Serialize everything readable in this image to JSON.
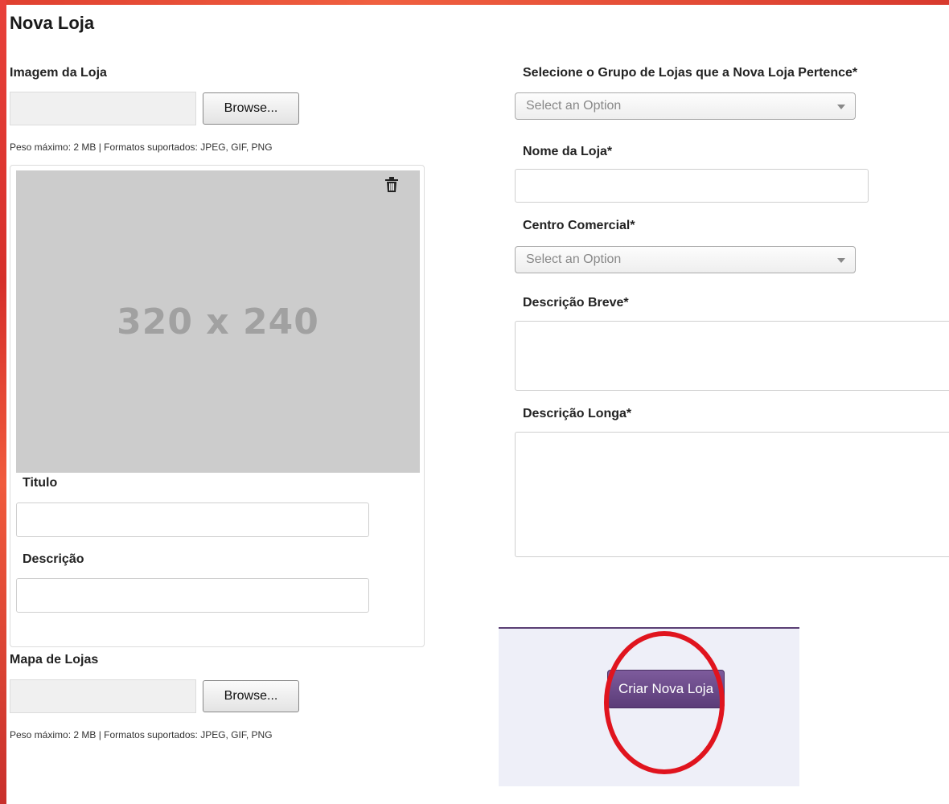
{
  "page": {
    "title": "Nova Loja"
  },
  "store_image": {
    "label": "Imagem da Loja",
    "browse_label": "Browse...",
    "hint": "Peso máximo: 2 MB | Formatos suportados: JPEG, GIF, PNG",
    "placeholder_text": "320 x 240",
    "title_label": "Titulo",
    "title_value": "",
    "description_label": "Descrição",
    "description_value": ""
  },
  "store_map": {
    "label": "Mapa de Lojas",
    "browse_label": "Browse...",
    "hint": "Peso máximo: 2 MB | Formatos suportados: JPEG, GIF, PNG"
  },
  "form": {
    "group_label": "Selecione o Grupo de Lojas que a Nova Loja Pertence*",
    "group_selected": "Select an Option",
    "name_label": "Nome da Loja*",
    "name_value": "",
    "mall_label": "Centro Comercial*",
    "mall_selected": "Select an Option",
    "short_desc_label": "Descrição Breve*",
    "short_desc_value": "",
    "long_desc_label": "Descrição Longa*",
    "long_desc_value": ""
  },
  "actions": {
    "create_label": "Criar Nova Loja"
  },
  "icons": {
    "delete": "trash-icon",
    "dropdown": "chevron-down-icon"
  },
  "colors": {
    "accent": "#5b3c78",
    "panel_bg": "#eeeff8",
    "highlight": "#e0141e",
    "placeholder_bg": "#cccccc"
  }
}
